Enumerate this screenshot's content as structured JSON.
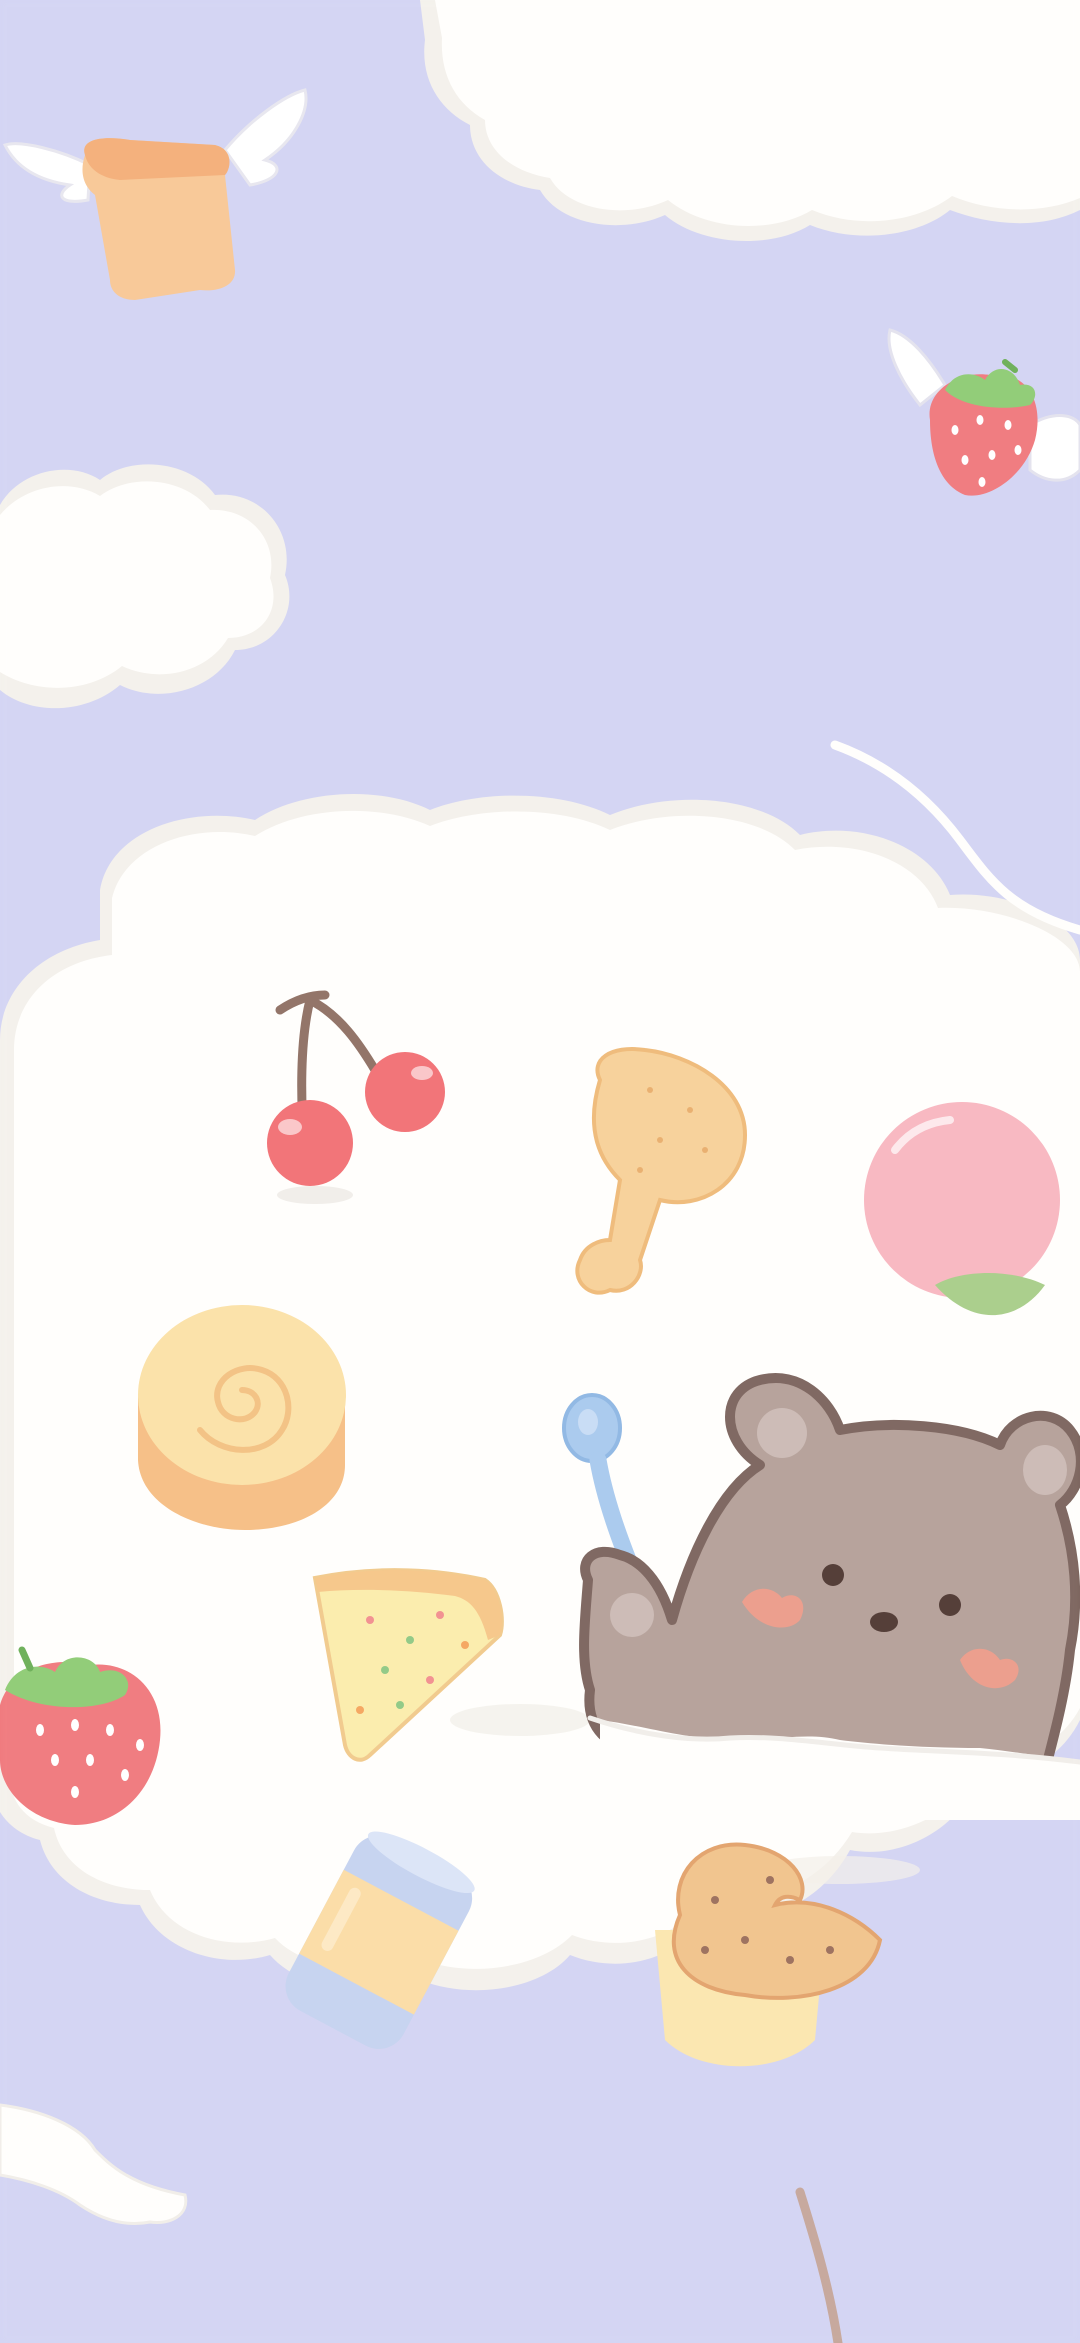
{
  "wallpaper": {
    "colors": {
      "sky": "#d3d4f3",
      "cloud": "#fffefc",
      "cloud_edge": "#f4f1ec",
      "bear_fur": "#b49f98",
      "bear_outline": "#7b635c",
      "blush": "#ec9b89",
      "strawberry": "#f0787c",
      "cherry": "#f26f73",
      "peach": "#f8b6c0",
      "leaf": "#a8cd88",
      "spoon": "#a8c9ee",
      "roll": "#fbe1a7",
      "roll_edge": "#f6be83",
      "drumstick": "#f7d198",
      "can": "#c5d3f0",
      "stick": "#c5a69a"
    },
    "icons": [
      "flying-toast-icon",
      "flying-strawberry-icon",
      "cherry-icon",
      "drumstick-icon",
      "peach-icon",
      "swiss-roll-icon",
      "spoon-icon",
      "bear-icon",
      "pizza-slice-icon",
      "strawberry-icon",
      "soda-can-icon",
      "donut-icon"
    ]
  }
}
